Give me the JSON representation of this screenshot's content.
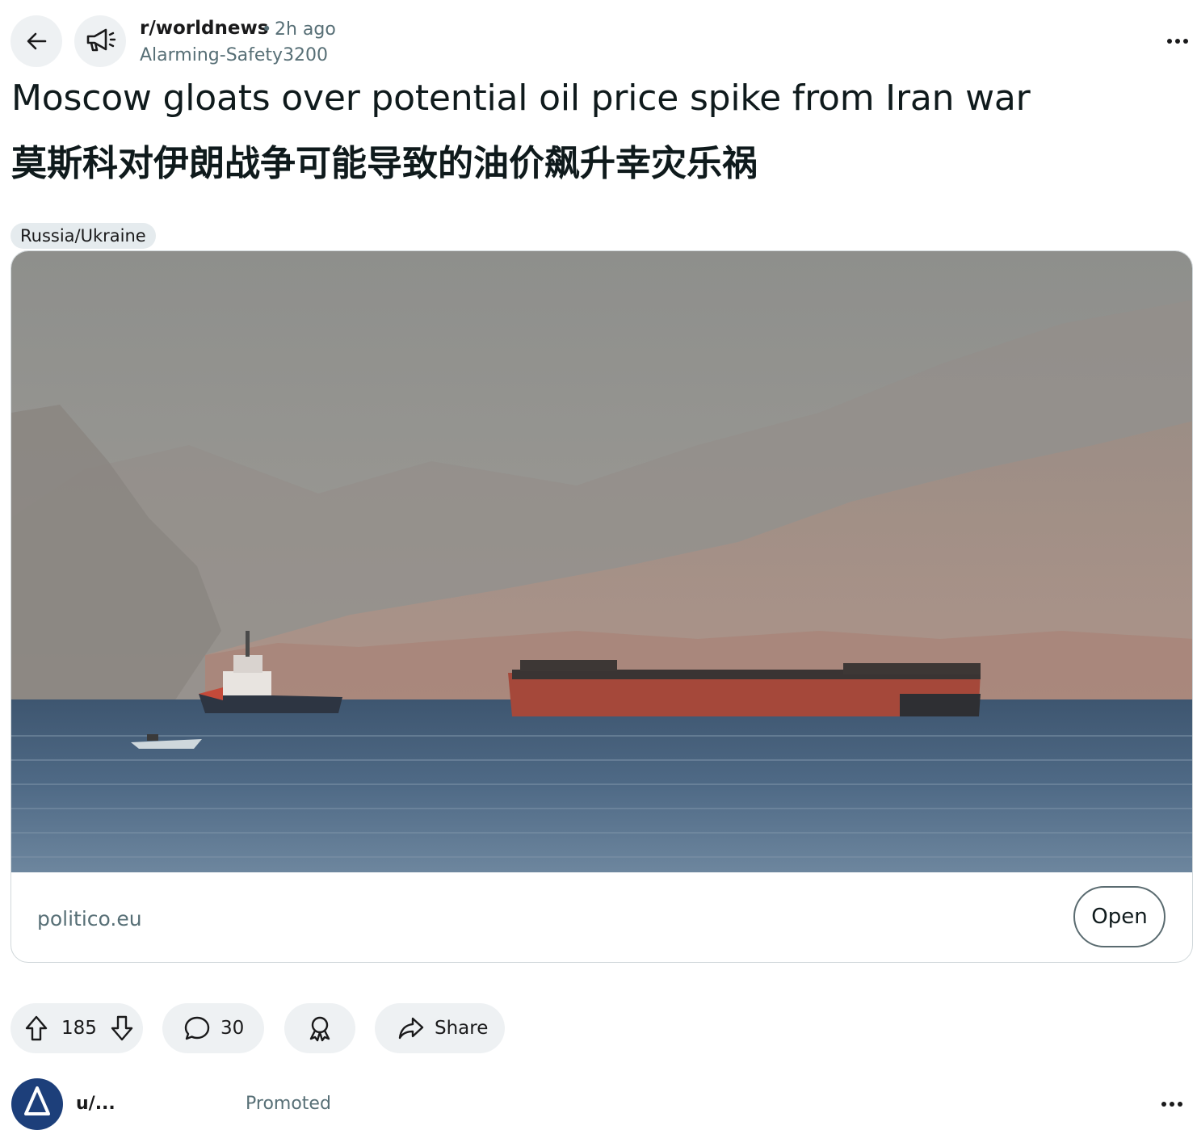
{
  "header": {
    "back_icon": "arrow-left-icon",
    "subreddit_icon": "megaphone-icon",
    "subreddit": "r/worldnews",
    "separator": "•",
    "time": "2h ago",
    "author": "Alarming-Safety3200",
    "more_icon": "ellipsis-icon"
  },
  "post": {
    "title_en": "Moscow gloats over potential oil price spike from Iran war",
    "title_zh": "莫斯科对伊朗战争可能导致的油价飙升幸灾乐祸",
    "flair": "Russia/Ukraine"
  },
  "link_card": {
    "image_subject": "tugboat and barge on the sea before hazy mountains",
    "domain": "politico.eu",
    "open_label": "Open"
  },
  "actions": {
    "upvote_icon": "arrow-up-icon",
    "score": "185",
    "downvote_icon": "arrow-down-icon",
    "comment_icon": "speech-bubble-icon",
    "comments": "30",
    "award_icon": "award-ribbon-icon",
    "share_icon": "share-arrow-icon",
    "share_label": "Share"
  },
  "next_post": {
    "name": "u/...",
    "promoted": "Promoted"
  }
}
